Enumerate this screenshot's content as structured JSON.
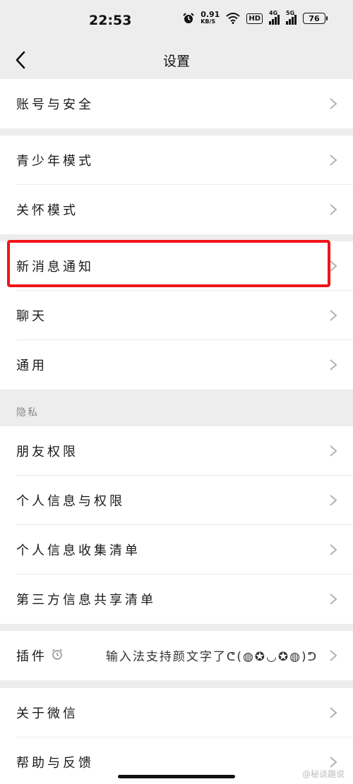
{
  "status_bar": {
    "time": "22:53",
    "net_speed": "0.91",
    "net_unit": "KB/S",
    "hd": "HD",
    "signal1": "4G",
    "signal2": "5G",
    "battery": "76"
  },
  "header": {
    "title": "设置"
  },
  "sections": {
    "account": {
      "items": [
        {
          "label": "账号与安全"
        }
      ]
    },
    "modes": {
      "items": [
        {
          "label": "青少年模式"
        },
        {
          "label": "关怀模式"
        }
      ]
    },
    "general": {
      "items": [
        {
          "label": "新消息通知"
        },
        {
          "label": "聊天"
        },
        {
          "label": "通用"
        }
      ]
    },
    "privacy": {
      "header": "隐私",
      "items": [
        {
          "label": "朋友权限"
        },
        {
          "label": "个人信息与权限"
        },
        {
          "label": "个人信息收集清单"
        },
        {
          "label": "第三方信息共享清单"
        }
      ]
    },
    "plugins": {
      "items": [
        {
          "label": "插件",
          "value": "输入法支持颜文字了ᕦ(◍✪◡✪◍)ᕤ"
        }
      ]
    },
    "about": {
      "items": [
        {
          "label": "关于微信"
        },
        {
          "label": "帮助与反馈"
        }
      ]
    }
  },
  "highlight": {
    "target": "新消息通知",
    "color": "#f0141a"
  },
  "watermark": "@秘谈趣说",
  "colors": {
    "background": "#ededed",
    "surface": "#ffffff",
    "chevron": "#b2b2b2"
  }
}
